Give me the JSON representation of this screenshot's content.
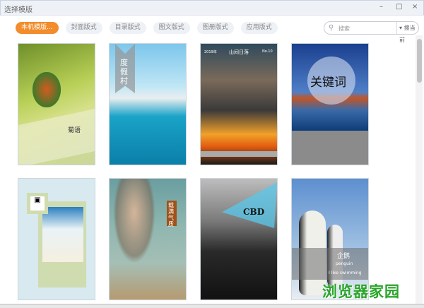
{
  "window": {
    "title": "选择模版",
    "minimize": "–",
    "maximize": "□",
    "close": "×"
  },
  "tabs": [
    "本机模版...",
    "封面版式",
    "目录版式",
    "图文版式",
    "图册版式",
    "应用版式"
  ],
  "search": {
    "placeholder": "搜索",
    "scope": "搜当前",
    "icon": "search-icon"
  },
  "templates": [
    {
      "title": "菊语"
    },
    {
      "title": "度假村"
    },
    {
      "year": "2019年",
      "title": "山间日落",
      "issue": "No.10"
    },
    {
      "title": "关键词"
    },
    {
      "title": ""
    },
    {
      "title": "载满气质"
    },
    {
      "title": "CBD"
    },
    {
      "title": "企鹅",
      "subtitle": "penguin",
      "caption": "I like swimming"
    }
  ],
  "watermark": "浏览器家园"
}
